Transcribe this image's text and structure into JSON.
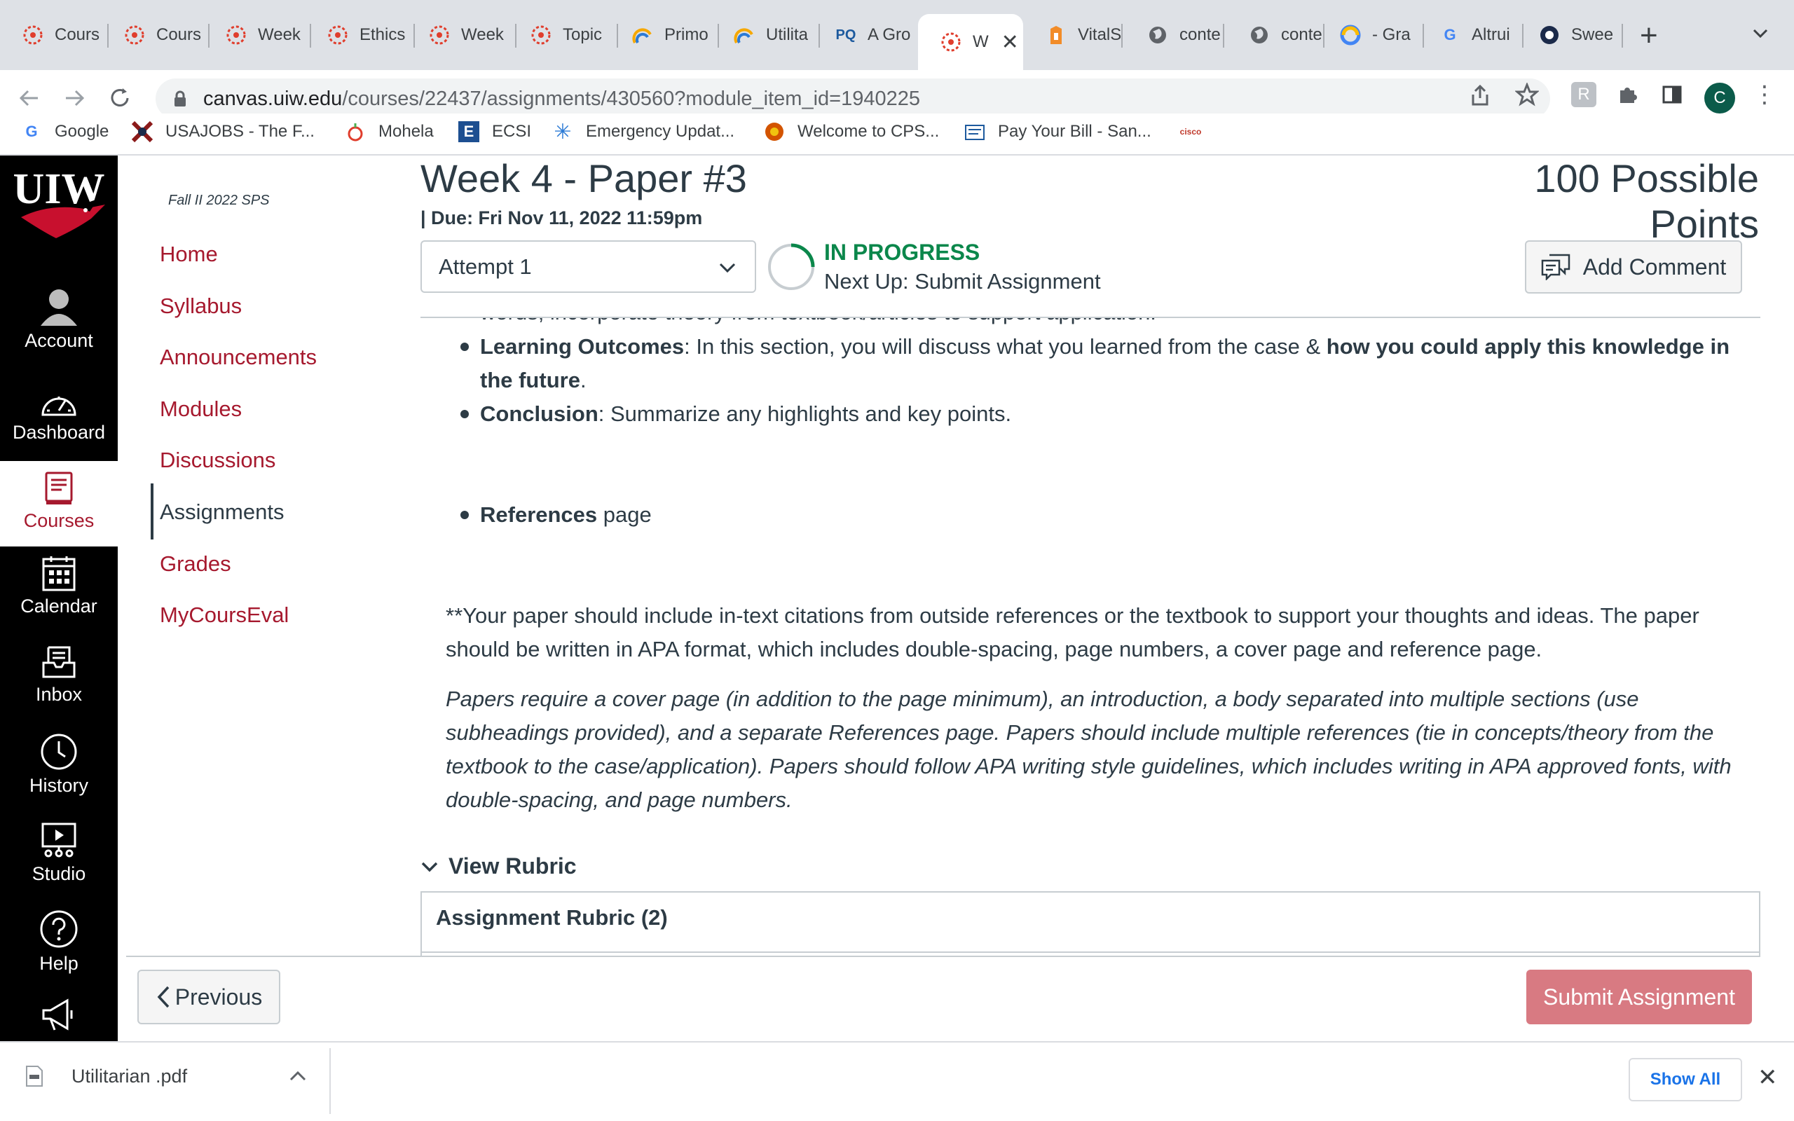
{
  "tabs": [
    {
      "label": "Cours",
      "icon": "canvas-icon"
    },
    {
      "label": "Cours",
      "icon": "canvas-icon"
    },
    {
      "label": "Week",
      "icon": "canvas-icon"
    },
    {
      "label": "Ethics",
      "icon": "canvas-icon"
    },
    {
      "label": "Week",
      "icon": "canvas-icon"
    },
    {
      "label": "Topic",
      "icon": "canvas-icon"
    },
    {
      "label": "Primo",
      "icon": "primo-icon"
    },
    {
      "label": "Utilita",
      "icon": "primo-icon"
    },
    {
      "label": "A Gro",
      "icon": "pq-icon",
      "icon_text": "PQ"
    },
    {
      "label": "W",
      "icon": "canvas-icon",
      "active": true
    },
    {
      "label": "VitalS",
      "icon": "vitalsource-icon"
    },
    {
      "label": "conte",
      "icon": "globe-icon"
    },
    {
      "label": "conte",
      "icon": "globe-icon"
    },
    {
      "label": "- Gra",
      "icon": "google-icon"
    },
    {
      "label": "Altrui",
      "icon": "google-g-icon",
      "icon_text": "G"
    },
    {
      "label": "Swee",
      "icon": "sweetwater-icon"
    }
  ],
  "browser": {
    "url_host": "canvas.uiw.edu",
    "url_path": "/courses/22437/assignments/430560?module_item_id=1940225",
    "profile_initial": "C"
  },
  "bookmarks": [
    {
      "label": "Google",
      "icon": "google-g-icon",
      "icon_text": "G"
    },
    {
      "label": "USAJOBS - The F...",
      "icon": "usajobs-icon"
    },
    {
      "label": "Mohela",
      "icon": "mohela-icon"
    },
    {
      "label": "ECSI",
      "icon": "ecsi-icon",
      "icon_text": "E"
    },
    {
      "label": "Emergency Updat...",
      "icon": "snowflake-icon"
    },
    {
      "label": "Welcome to CPS...",
      "icon": "cps-icon"
    },
    {
      "label": "Pay Your Bill - San...",
      "icon": "bill-icon"
    },
    {
      "label": "",
      "icon": "cisco-icon",
      "icon_text": "cisco"
    }
  ],
  "global_nav": {
    "logo_text": "UIW",
    "items": [
      {
        "label": "Account",
        "icon": "account-icon"
      },
      {
        "label": "Dashboard",
        "icon": "dashboard-icon"
      },
      {
        "label": "Courses",
        "icon": "courses-icon",
        "active": true
      },
      {
        "label": "Calendar",
        "icon": "calendar-icon"
      },
      {
        "label": "Inbox",
        "icon": "inbox-icon"
      },
      {
        "label": "History",
        "icon": "history-icon"
      },
      {
        "label": "Studio",
        "icon": "studio-icon"
      },
      {
        "label": "Help",
        "icon": "help-icon"
      }
    ]
  },
  "course_nav": {
    "term": "Fall II 2022 SPS",
    "items": [
      "Home",
      "Syllabus",
      "Announcements",
      "Modules",
      "Discussions",
      "Assignments",
      "Grades",
      "MyCoursEval"
    ],
    "active": "Assignments"
  },
  "assignment": {
    "title": "Week 4 - Paper #3",
    "due": "| Due: Fri Nov 11, 2022 11:59pm",
    "points": "100 Possible Points",
    "attempt": "Attempt 1",
    "status": "IN PROGRESS",
    "next_up": "Next Up: Submit Assignment",
    "add_comment": "Add Comment"
  },
  "content": {
    "cut_line": "words, incorporate theory from textbook/articles to support application.",
    "outcomes_label": "Learning Outcomes",
    "outcomes_text": ": In this section, you will discuss what you learned from the case & ",
    "outcomes_bold": "how you could apply this knowledge in the future",
    "outcomes_end": ".",
    "conclusion_label": "Conclusion",
    "conclusion_text": ": Summarize any highlights and key points.",
    "references_label": "References",
    "references_text": " page",
    "para1": "**Your paper should include in-text citations from outside references or the textbook to support your thoughts and ideas.  The paper should be written in APA format, which includes double-spacing, page numbers, a cover page and reference page.",
    "para2": "Papers require a cover page (in addition to the page minimum), an introduction, a body separated into multiple sections (use subheadings provided), and a separate References page. Papers should include multiple references (tie in concepts/theory from the textbook to the case/application). Papers should follow APA writing style guidelines, which includes writing in APA approved fonts, with double-spacing, and page numbers.",
    "view_rubric": "View Rubric",
    "rubric_title": "Assignment Rubric (2)"
  },
  "footer": {
    "previous": "Previous",
    "submit": "Submit Assignment"
  },
  "download": {
    "file": "Utilitarian .pdf",
    "show_all": "Show All"
  },
  "colors": {
    "brand_red": "#a6192e",
    "status_green": "#0b874b",
    "submit_pink": "#d87a82"
  }
}
